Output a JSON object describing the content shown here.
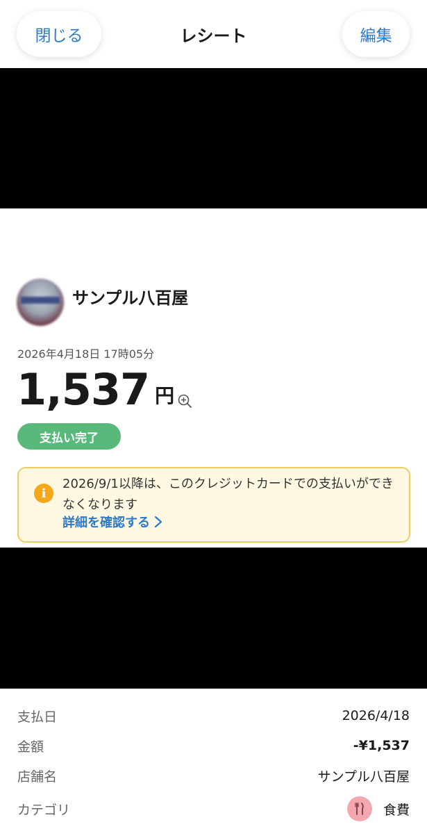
{
  "header": {
    "close_label": "閉じる",
    "title": "レシート",
    "edit_label": "編集"
  },
  "merchant": {
    "name": "サンプル八百屋",
    "datetime": "2026年4月18日 17時05分",
    "amount": "1,537",
    "currency_unit": "円",
    "status": "支払い完了"
  },
  "notice": {
    "message": "2026/9/1以降は、このクレジットカードでの支払いができなくなります",
    "link_label": "詳細を確認する"
  },
  "details": {
    "rows": [
      {
        "label": "支払日",
        "value": "2026/4/18"
      },
      {
        "label": "金額",
        "value": "-¥1,537"
      },
      {
        "label": "店舗名",
        "value": "サンプル八百屋"
      },
      {
        "label": "カテゴリ",
        "value": "食費",
        "icon": "utensils-icon"
      }
    ]
  },
  "colors": {
    "accent": "#2e79c8",
    "status_green": "#58b97a",
    "notice_background": "#fff9e4",
    "notice_border": "#efcd63",
    "info_icon": "#f5a81c",
    "category_icon_bg": "#f2a8ae"
  }
}
